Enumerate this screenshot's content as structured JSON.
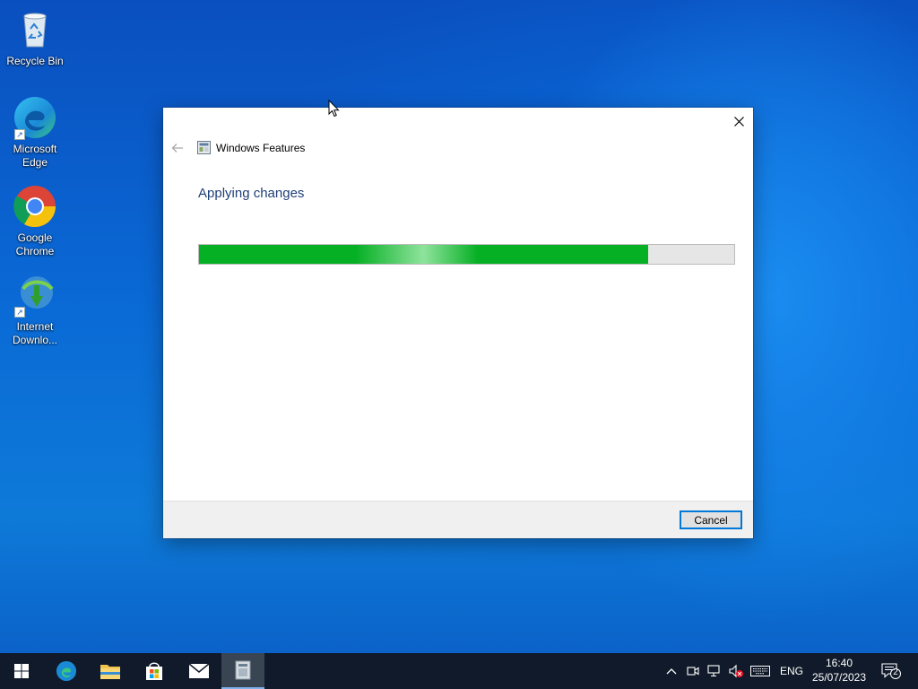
{
  "desktop": {
    "icons": [
      {
        "label": "Recycle Bin",
        "icon": "recycle-bin-icon"
      },
      {
        "label": "Microsoft Edge",
        "icon": "edge-icon"
      },
      {
        "label": "Google Chrome",
        "icon": "chrome-icon"
      },
      {
        "label": "Internet Downlo...",
        "icon": "idm-icon"
      }
    ]
  },
  "dialog": {
    "title": "Windows Features",
    "heading": "Applying changes",
    "progress_percent": 84,
    "cancel_label": "Cancel",
    "close_icon": "close-icon",
    "back_icon": "back-arrow-icon"
  },
  "taskbar": {
    "apps": [
      "start-icon",
      "edge-icon",
      "file-explorer-icon",
      "store-icon",
      "mail-icon",
      "windows-features-icon"
    ],
    "tray": {
      "language": "ENG",
      "time": "16:40",
      "date": "25/07/2023",
      "notification_count": "2"
    }
  },
  "colors": {
    "progress": "#06b025",
    "accent": "#0078d7",
    "heading": "#1f3f78",
    "taskbar": "#101a2a"
  }
}
